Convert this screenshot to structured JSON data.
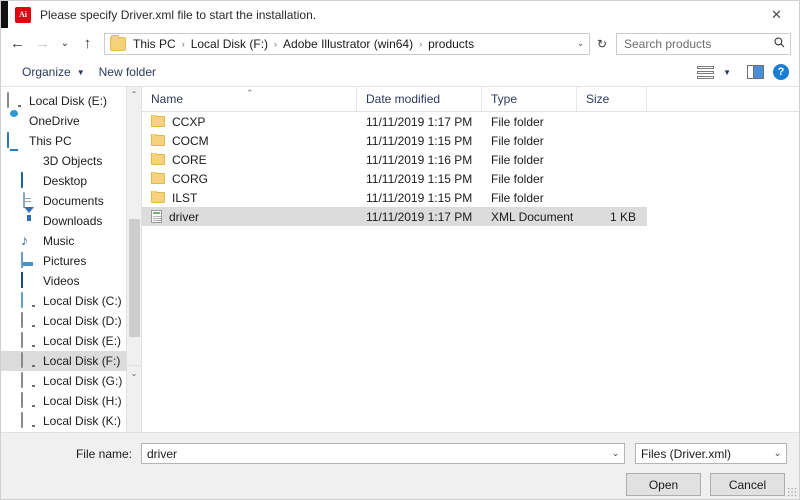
{
  "titlebar": {
    "icon": "adobe-illustrator-icon",
    "title": "Please specify Driver.xml file to start the installation.",
    "close_label": "✕"
  },
  "navbar": {
    "back_icon": "←",
    "forward_icon": "→",
    "recent_icon": "⌄",
    "up_icon": "↑",
    "breadcrumbs": [
      "This PC",
      "Local Disk (F:)",
      "Adobe Illustrator (win64)",
      "products"
    ],
    "separator": "›",
    "address_dropdown_icon": "⌄",
    "refresh_icon": "↻",
    "search": {
      "placeholder": "Search products",
      "value": "",
      "icon": "🔍"
    }
  },
  "commandbar": {
    "organize_label": "Organize",
    "organize_caret": "▼",
    "new_folder_label": "New folder",
    "view_icon": "view-list-icon",
    "view_caret": "▼",
    "preview_pane_icon": "preview-pane-icon",
    "help_label": "?"
  },
  "sidebar": {
    "items": [
      {
        "label": "Local Disk (E:)",
        "icon": "drive-icon",
        "indent": false,
        "selected": false
      },
      {
        "label": "OneDrive",
        "icon": "cloud-icon",
        "indent": false,
        "selected": false
      },
      {
        "label": "This PC",
        "icon": "computer-icon",
        "indent": false,
        "selected": false
      },
      {
        "label": "3D Objects",
        "icon": "cube-icon",
        "indent": true,
        "selected": false
      },
      {
        "label": "Desktop",
        "icon": "desktop-icon",
        "indent": true,
        "selected": false
      },
      {
        "label": "Documents",
        "icon": "document-icon",
        "indent": true,
        "selected": false
      },
      {
        "label": "Downloads",
        "icon": "download-icon",
        "indent": true,
        "selected": false
      },
      {
        "label": "Music",
        "icon": "music-icon",
        "indent": true,
        "selected": false
      },
      {
        "label": "Pictures",
        "icon": "picture-icon",
        "indent": true,
        "selected": false
      },
      {
        "label": "Videos",
        "icon": "video-icon",
        "indent": true,
        "selected": false
      },
      {
        "label": "Local Disk (C:)",
        "icon": "system-drive-icon",
        "indent": true,
        "selected": false
      },
      {
        "label": "Local Disk (D:)",
        "icon": "drive-icon",
        "indent": true,
        "selected": false
      },
      {
        "label": "Local Disk (E:)",
        "icon": "drive-icon",
        "indent": true,
        "selected": false
      },
      {
        "label": "Local Disk (F:)",
        "icon": "drive-icon",
        "indent": true,
        "selected": true
      },
      {
        "label": "Local Disk (G:)",
        "icon": "drive-icon",
        "indent": true,
        "selected": false
      },
      {
        "label": "Local Disk (H:)",
        "icon": "drive-icon",
        "indent": true,
        "selected": false
      },
      {
        "label": "Local Disk (K:)",
        "icon": "drive-icon",
        "indent": true,
        "selected": false
      }
    ],
    "scroll_up_icon": "⌃",
    "scroll_down_icon": "⌄"
  },
  "filelist": {
    "columns": [
      "Name",
      "Date modified",
      "Type",
      "Size"
    ],
    "sort_indicator": "⌃",
    "rows": [
      {
        "name": "CCXP",
        "date": "11/11/2019 1:17 PM",
        "type": "File folder",
        "size": "",
        "icon": "folder-icon",
        "selected": false
      },
      {
        "name": "COCM",
        "date": "11/11/2019 1:15 PM",
        "type": "File folder",
        "size": "",
        "icon": "folder-icon",
        "selected": false
      },
      {
        "name": "CORE",
        "date": "11/11/2019 1:16 PM",
        "type": "File folder",
        "size": "",
        "icon": "folder-icon",
        "selected": false
      },
      {
        "name": "CORG",
        "date": "11/11/2019 1:15 PM",
        "type": "File folder",
        "size": "",
        "icon": "folder-icon",
        "selected": false
      },
      {
        "name": "ILST",
        "date": "11/11/2019 1:15 PM",
        "type": "File folder",
        "size": "",
        "icon": "folder-icon",
        "selected": false
      },
      {
        "name": "driver",
        "date": "11/11/2019 1:17 PM",
        "type": "XML Document",
        "size": "1 KB",
        "icon": "xml-document-icon",
        "selected": true
      }
    ]
  },
  "bottom": {
    "filename_label": "File name:",
    "filename_value": "driver",
    "filename_placeholder": "",
    "filename_caret": "⌄",
    "filter_value": "Files (Driver.xml)",
    "filter_caret": "⌄",
    "open_label": "Open",
    "cancel_label": "Cancel",
    "resize_grip": "resize-grip"
  },
  "colors": {
    "selection": "#dcdcdc",
    "accent": "#1a7fd4",
    "folder": "#f6d27e",
    "app_red": "#e3000f",
    "header_text": "#2b3a5c"
  }
}
